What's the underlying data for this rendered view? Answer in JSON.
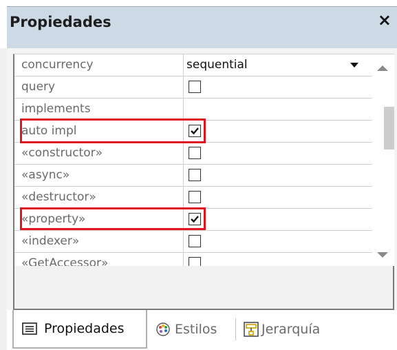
{
  "panel": {
    "title": "Propiedades",
    "close_glyph": "×"
  },
  "properties": [
    {
      "name": "concurrency",
      "type": "dropdown",
      "value": "sequential"
    },
    {
      "name": "query",
      "type": "checkbox",
      "checked": false
    },
    {
      "name": "implements",
      "type": "empty"
    },
    {
      "name": "auto impl",
      "type": "checkbox",
      "checked": true,
      "highlighted": true
    },
    {
      "name": "«constructor»",
      "type": "checkbox",
      "checked": false
    },
    {
      "name": "«async»",
      "type": "checkbox",
      "checked": false
    },
    {
      "name": "«destructor»",
      "type": "checkbox",
      "checked": false
    },
    {
      "name": "«property»",
      "type": "checkbox",
      "checked": true,
      "highlighted": true
    },
    {
      "name": "«indexer»",
      "type": "checkbox",
      "checked": false
    },
    {
      "name": "«GetAccessor»",
      "type": "checkbox",
      "checked": false
    }
  ],
  "tabs": [
    {
      "label": "Propiedades",
      "icon": "properties-list-icon",
      "active": true
    },
    {
      "label": "Estilos",
      "icon": "palette-icon",
      "active": false
    },
    {
      "label": "Jerarquía",
      "icon": "hierarchy-icon",
      "active": false
    }
  ],
  "colors": {
    "highlight": "#e0141e",
    "title_bg": "#ced9e6"
  }
}
